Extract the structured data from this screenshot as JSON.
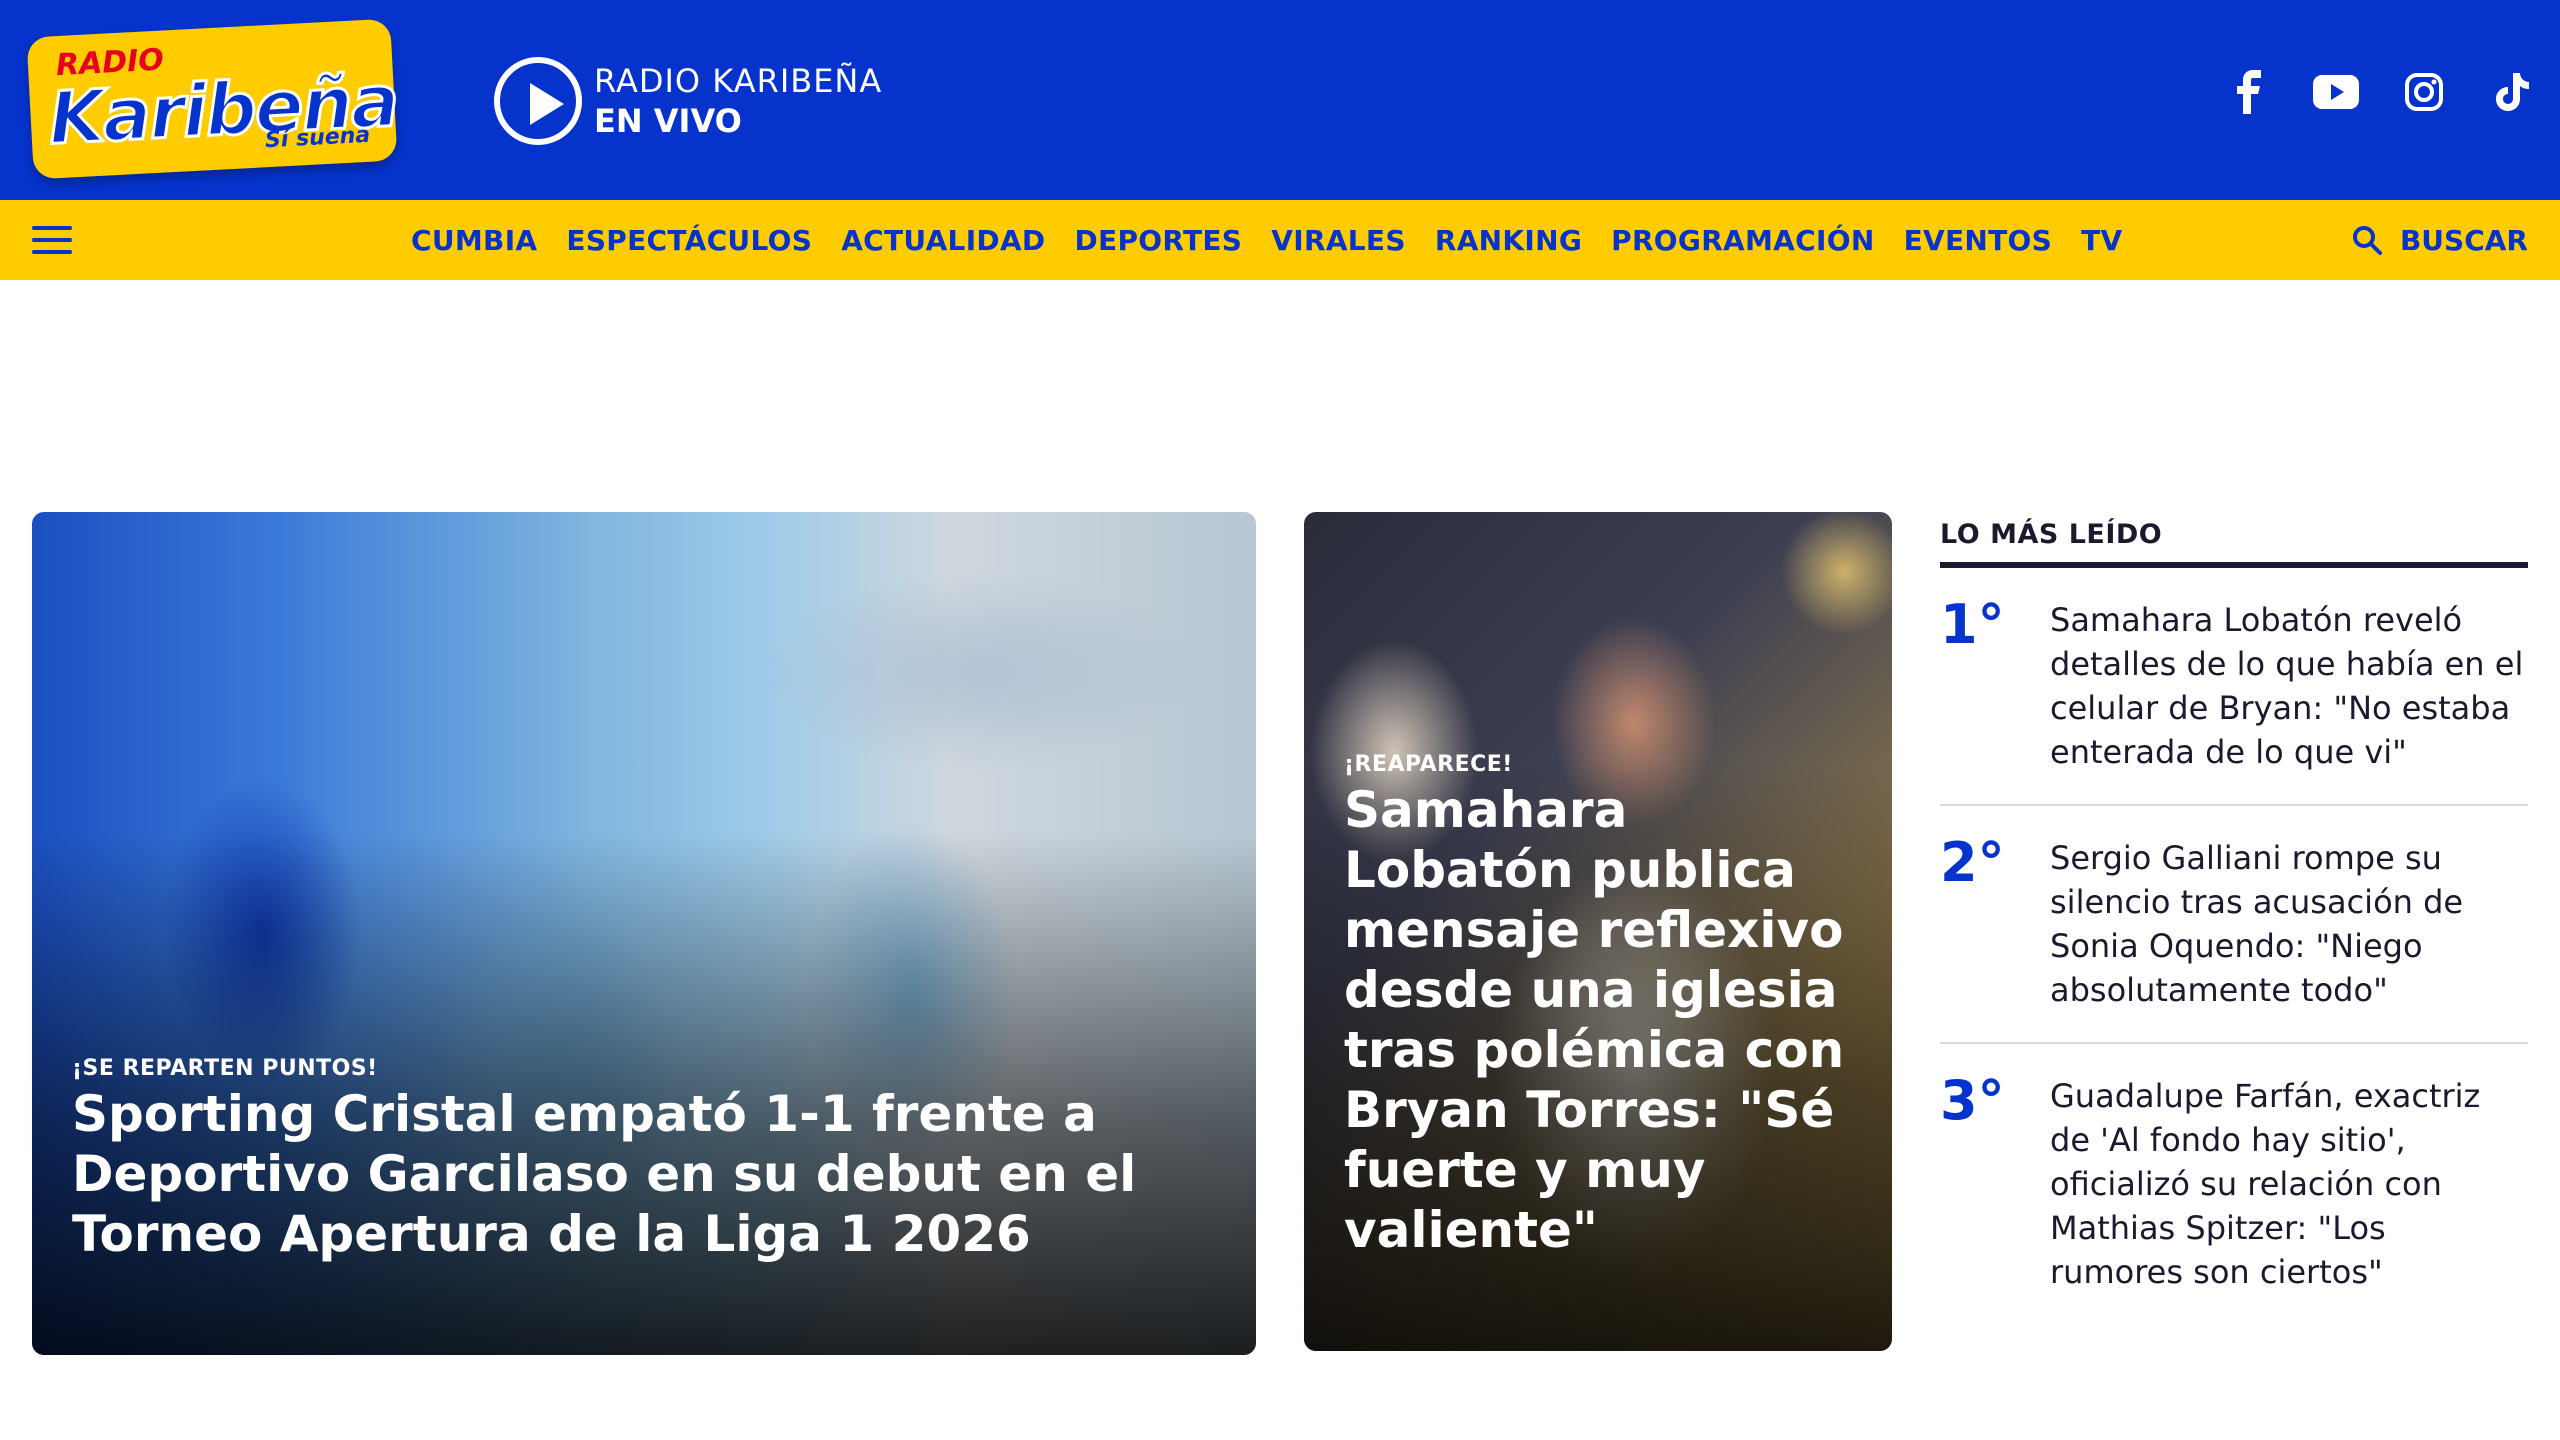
{
  "header": {
    "logo": {
      "radio": "RADIO",
      "name": "Karibeña",
      "tagline": "Sí suena"
    },
    "live": {
      "station": "RADIO KARIBEÑA",
      "status": "EN VIVO"
    },
    "socials": [
      "facebook-icon",
      "youtube-icon",
      "instagram-icon",
      "tiktok-icon"
    ],
    "brand_blue": "#0533cc",
    "brand_yellow": "#ffcc00"
  },
  "nav": {
    "items": [
      "CUMBIA",
      "ESPECTÁCULOS",
      "ACTUALIDAD",
      "DEPORTES",
      "VIRALES",
      "RANKING",
      "PROGRAMACIÓN",
      "EVENTOS",
      "TV"
    ],
    "search_label": "BUSCAR"
  },
  "featured": [
    {
      "tag": "¡SE REPARTEN PUNTOS!",
      "title": "Sporting Cristal empató 1-1 frente a Deportivo Garcilaso en su debut en el Torneo Apertura de la Liga 1 2026"
    },
    {
      "tag": "¡REAPARECE!",
      "title": "Samahara Lobatón publica mensaje reflexivo desde una iglesia tras polémica con Bryan Torres: \"Sé fuerte y muy valiente\""
    }
  ],
  "most_read": {
    "title": "LO MÁS LEÍDO",
    "items": [
      {
        "rank": "1°",
        "text": "Samahara Lobatón reveló detalles de lo que había en el celular de Bryan: \"No estaba enterada de lo que vi\""
      },
      {
        "rank": "2°",
        "text": "Sergio Galliani rompe su silencio tras acusación de Sonia Oquendo: \"Niego absolutamente todo\""
      },
      {
        "rank": "3°",
        "text": "Guadalupe Farfán, exactriz de 'Al fondo hay sitio', oficializó su relación con Mathias Spitzer: \"Los rumores son ciertos\""
      }
    ]
  }
}
